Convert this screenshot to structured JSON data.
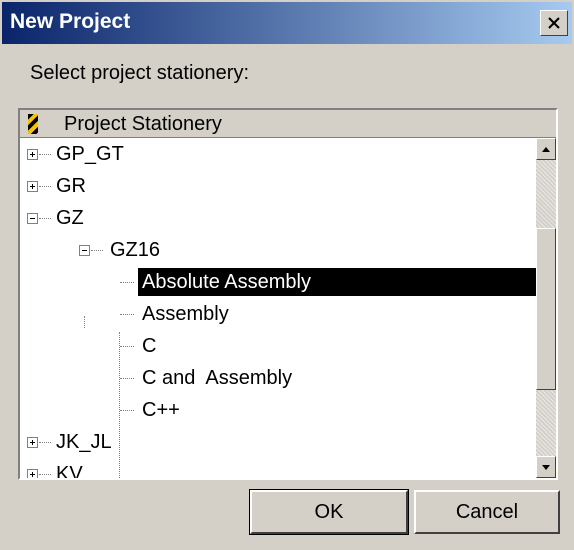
{
  "window": {
    "title": "New Project",
    "close_glyph": "X"
  },
  "prompt": "Select project stationery:",
  "tree": {
    "header_icon": "stationery-icon",
    "header_label": "Project Stationery",
    "items": [
      {
        "label": "GP_GT",
        "state": "collapsed"
      },
      {
        "label": "GR",
        "state": "collapsed"
      },
      {
        "label": "GZ",
        "state": "expanded"
      },
      {
        "label": "GZ16",
        "state": "expanded"
      },
      {
        "label": "Absolute Assembly",
        "selected": true
      },
      {
        "label": "Assembly"
      },
      {
        "label": "C"
      },
      {
        "label": "C and  Assembly"
      },
      {
        "label": "C++"
      },
      {
        "label": "JK_JL",
        "state": "collapsed"
      },
      {
        "label": "KV",
        "state": "collapsed"
      }
    ]
  },
  "buttons": {
    "ok": "OK",
    "cancel": "Cancel"
  },
  "colors": {
    "title_bar": "#0a246a",
    "selection": "#000000",
    "face": "#d4d0c8"
  }
}
